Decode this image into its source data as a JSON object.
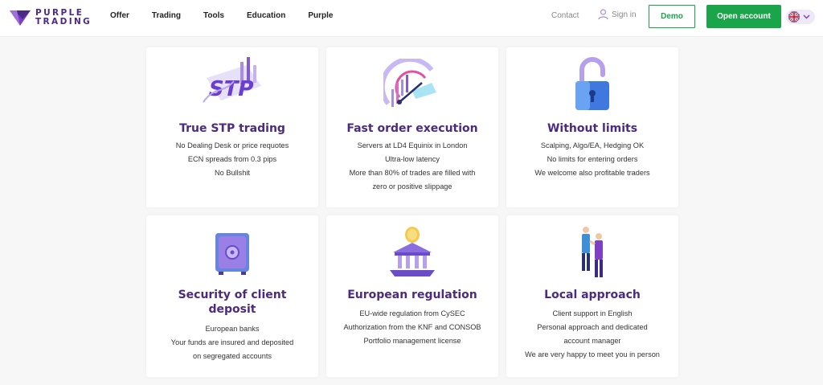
{
  "brand": {
    "line1": "PURPLE",
    "line2": "TRADING"
  },
  "nav": {
    "items": [
      "Offer",
      "Trading",
      "Tools",
      "Education",
      "Purple"
    ]
  },
  "header_right": {
    "contact": "Contact",
    "signin": "Sign in",
    "demo": "Demo",
    "open_account": "Open account"
  },
  "colors": {
    "brand_purple": "#4b2a7f",
    "accent_green": "#1aa54b"
  },
  "cards": [
    {
      "icon": "stp-icon",
      "title": "True STP trading",
      "lines": [
        "No Dealing Desk or price requotes",
        "ECN spreads from 0.3 pips",
        "No Bullshit"
      ]
    },
    {
      "icon": "speedometer-icon",
      "title": "Fast order execution",
      "lines": [
        "Servers at LD4 Equinix in London",
        "Ultra-low latency",
        "More than 80% of trades are filled with",
        "zero or positive slippage"
      ]
    },
    {
      "icon": "padlock-icon",
      "title": "Without limits",
      "lines": [
        "Scalping, Algo/EA, Hedging OK",
        "No limits for entering orders",
        "We welcome also profitable traders"
      ]
    },
    {
      "icon": "safe-icon",
      "title_lines": [
        "Security of client",
        "deposit"
      ],
      "lines": [
        "European banks",
        "Your funds are insured and deposited",
        "on segregated accounts"
      ]
    },
    {
      "icon": "bank-icon",
      "title": "European regulation",
      "lines": [
        "EU-wide regulation from CySEC",
        "Authorization from the KNF and CONSOB",
        "Portfolio management license"
      ]
    },
    {
      "icon": "handshake-icon",
      "title": "Local approach",
      "lines": [
        "Client support in English",
        "Personal approach and dedicated",
        "account manager",
        "We are very happy to meet you in person"
      ]
    }
  ]
}
